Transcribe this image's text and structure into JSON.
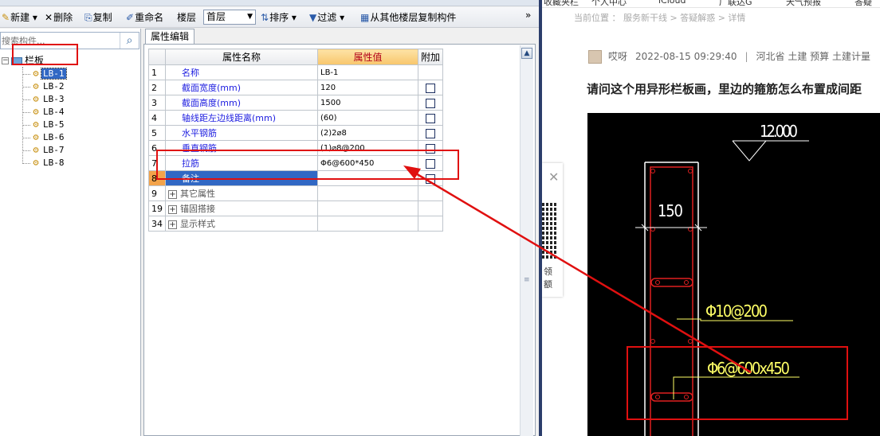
{
  "app": {
    "toolbar": {
      "new_label": "新建",
      "delete_label": "删除",
      "copy_label": "复制",
      "rename_label": "重命名",
      "floor_label": "楼层",
      "floor_value": "首层",
      "sort_label": "排序",
      "filter_label": "过滤",
      "copy_from_floor_label": "从其他楼层复制构件",
      "more": "»"
    },
    "tree": {
      "search_placeholder": "搜索构件...",
      "root_label": "栏板",
      "items": [
        "LB-1",
        "LB-2",
        "LB-3",
        "LB-4",
        "LB-5",
        "LB-6",
        "LB-7",
        "LB-8"
      ],
      "selected": "LB-1"
    },
    "properties": {
      "tab_label": "属性编辑",
      "headers": {
        "name": "属性名称",
        "value": "属性值",
        "extra": "附加"
      },
      "rows": [
        {
          "num": "1",
          "name": "名称",
          "value": "LB-1",
          "checkbox": false
        },
        {
          "num": "2",
          "name": "截面宽度(mm)",
          "value": "120",
          "checkbox": true
        },
        {
          "num": "3",
          "name": "截面高度(mm)",
          "value": "1500",
          "checkbox": true
        },
        {
          "num": "4",
          "name": "轴线距左边线距离(mm)",
          "value": "(60)",
          "checkbox": true
        },
        {
          "num": "5",
          "name": "水平钢筋",
          "value": "(2)2⌀8",
          "checkbox": true
        },
        {
          "num": "6",
          "name": "垂直钢筋",
          "value": "(1)⌀8@200",
          "checkbox": true
        },
        {
          "num": "7",
          "name": "拉筋",
          "value": "Φ6@600*450",
          "checkbox": true
        },
        {
          "num": "8",
          "name": "备注",
          "value": "",
          "checkbox": true
        }
      ],
      "groups": [
        {
          "num": "9",
          "name": "其它属性"
        },
        {
          "num": "19",
          "name": "锚固搭接"
        },
        {
          "num": "34",
          "name": "显示样式"
        }
      ]
    }
  },
  "browser": {
    "bookmarks": [
      "收藏夹栏",
      "个人中心",
      "iCloud",
      "广联达G",
      "天气预报",
      "答疑"
    ],
    "breadcrumb": "当前位置 ： 服务新干线 > 答疑解惑 > 详情",
    "side_widget": {
      "line1": "领",
      "line2": "额"
    },
    "post": {
      "author": "哎呀",
      "datetime": "2022-08-15 09:29:40",
      "tags": "河北省  土建 预算 土建计量",
      "title": "请问这个用异形栏板画，里边的箍筋怎么布置成间距"
    },
    "cad": {
      "elevation": "12.000",
      "width_dim": "150",
      "rebar1": "Φ10@200",
      "rebar2": "Φ6@600x450"
    }
  },
  "colors": {
    "annotation": "#e01010",
    "selection": "#3168c4",
    "cad_line": "#ffffff",
    "cad_wall": "#e02020",
    "cad_text": "#ffff66"
  }
}
